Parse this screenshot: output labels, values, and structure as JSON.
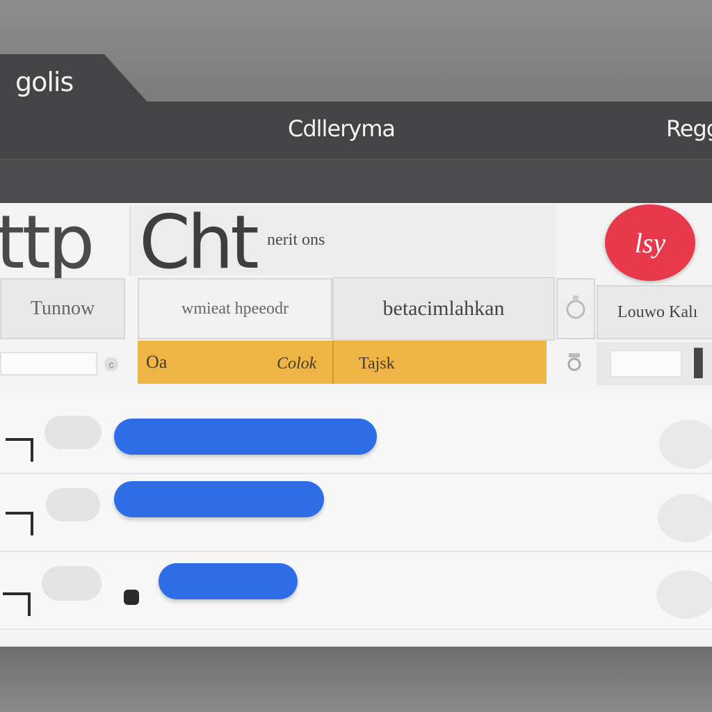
{
  "window": {
    "tab_label": "golis",
    "title": "Cdlleryma",
    "title_right": "Regg"
  },
  "header": {
    "big_left": "ttp",
    "big_title": "Cht",
    "subtext": "nerit ons",
    "badge_label": "lsy"
  },
  "columns": {
    "col1": "Tunnow",
    "col2": "wmieat hpeeodr",
    "col3": "betacimlahkan",
    "col5": "Louwo Kalı"
  },
  "highlight_row": {
    "label": "Oa",
    "col2": "Colok",
    "col3": "Tajsk"
  },
  "rows": [
    {
      "bar_value": 1.0
    },
    {
      "bar_value": 0.8
    },
    {
      "bar_value": 0.53
    }
  ],
  "colors": {
    "accent_blue": "#2e6de6",
    "highlight_orange": "#efb446",
    "badge_red": "#e8384b",
    "titlebar": "#444446"
  }
}
